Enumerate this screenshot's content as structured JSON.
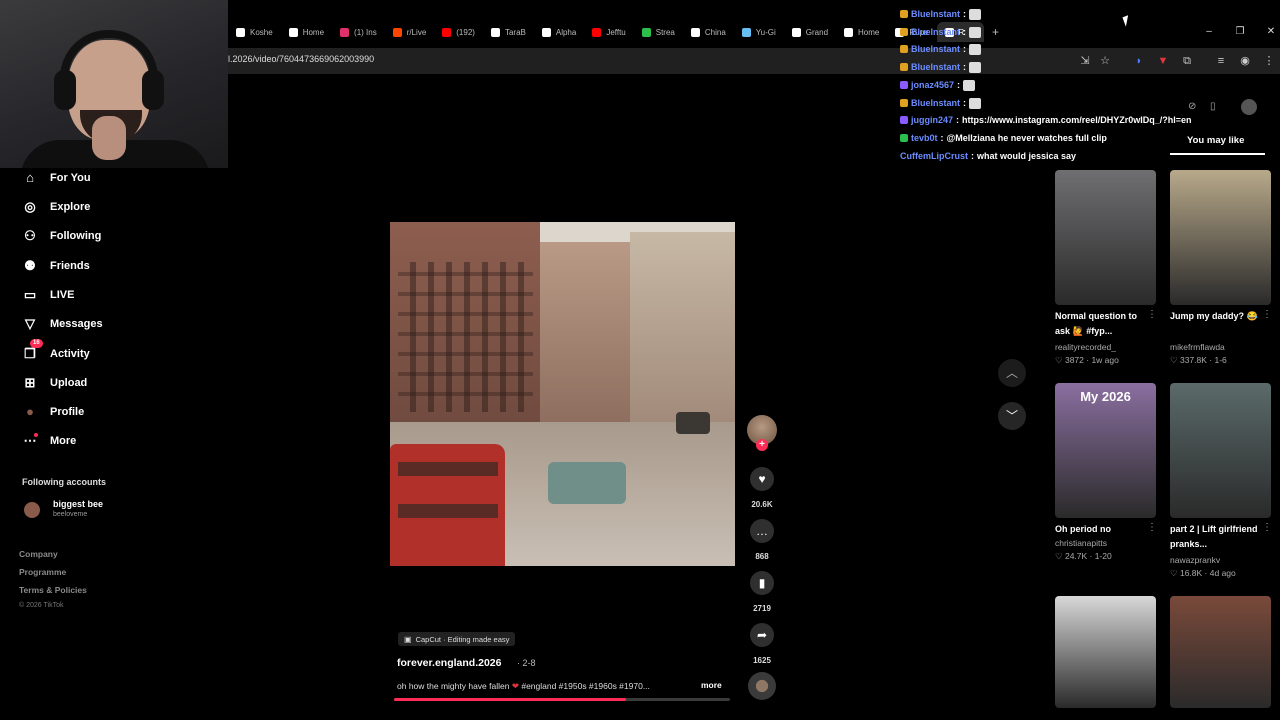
{
  "browser": {
    "tabs": [
      {
        "label": "Koshe",
        "icon": "x-logo-icon",
        "color": "#ffffff"
      },
      {
        "label": "Home",
        "icon": "x-logo-icon",
        "color": "#ffffff"
      },
      {
        "label": "(1) Ins",
        "icon": "instagram-icon",
        "color": "#e1306c"
      },
      {
        "label": "r/Live",
        "icon": "reddit-icon",
        "color": "#ff4500"
      },
      {
        "label": "(192)",
        "icon": "youtube-icon",
        "color": "#ff0000"
      },
      {
        "label": "TaraB",
        "icon": "x-logo-icon",
        "color": "#ffffff"
      },
      {
        "label": "Alpha",
        "icon": "x-logo-icon",
        "color": "#ffffff"
      },
      {
        "label": "Jefftu",
        "icon": "youtube-icon",
        "color": "#ff0000"
      },
      {
        "label": "Strea",
        "icon": "chart-icon",
        "color": "#2bbf4b"
      },
      {
        "label": "China",
        "icon": "x-logo-icon",
        "color": "#ffffff"
      },
      {
        "label": "Yu-Gi",
        "icon": "steam-icon",
        "color": "#66c0f4"
      },
      {
        "label": "Grand",
        "icon": "x-logo-icon",
        "color": "#ffffff"
      },
      {
        "label": "Home",
        "icon": "x-logo-icon",
        "color": "#ffffff"
      },
      {
        "label": "Rupe",
        "icon": "x-logo-icon",
        "color": "#ffffff"
      },
      {
        "label": "R",
        "icon": "tiktok-icon",
        "color": "#ffffff",
        "active": true
      }
    ],
    "new_tab": "+",
    "url": "l.2026/video/7604473669062003990",
    "window": {
      "minimize": "–",
      "restore": "❐",
      "close": "✕"
    }
  },
  "sidebar": {
    "items": [
      {
        "label": "For You",
        "icon": "home-icon",
        "glyph": "⌂"
      },
      {
        "label": "Explore",
        "icon": "compass-icon",
        "glyph": "◎"
      },
      {
        "label": "Following",
        "icon": "following-icon",
        "glyph": "⚇"
      },
      {
        "label": "Friends",
        "icon": "friends-icon",
        "glyph": "⚉"
      },
      {
        "label": "LIVE",
        "icon": "live-icon",
        "glyph": "▭"
      },
      {
        "label": "Messages",
        "icon": "messages-icon",
        "glyph": "▽"
      },
      {
        "label": "Activity",
        "icon": "activity-icon",
        "glyph": "❐",
        "badge": "16"
      },
      {
        "label": "Upload",
        "icon": "upload-icon",
        "glyph": "⊞"
      },
      {
        "label": "Profile",
        "icon": "profile-avatar-icon",
        "glyph": "●"
      },
      {
        "label": "More",
        "icon": "more-icon",
        "glyph": "⋯"
      }
    ],
    "following_title": "Following accounts",
    "following": [
      {
        "name": "biggest bee",
        "handle": "beeloveme"
      }
    ],
    "footer": [
      "Company",
      "Programme",
      "Terms & Policies"
    ],
    "copyright": "© 2026 TikTok"
  },
  "video": {
    "capcut": "CapCut · Editing made easy",
    "author": "forever.england.2026",
    "date": "· 2-8",
    "description": "oh how the mighty have fallen",
    "heart": "❤",
    "tags": "#england #1950s #1960s #1970...",
    "more": "more",
    "progress": 0.69
  },
  "actions": {
    "likes": "20.6K",
    "comments": "868",
    "saves": "2719",
    "shares": "1625"
  },
  "chat": [
    {
      "user": "BlueInstant",
      "text": "",
      "badge": "#e0a020",
      "emote": true
    },
    {
      "user": "BlueInstant",
      "text": "",
      "badge": "#e0a020",
      "emote": true
    },
    {
      "user": "BlueInstant",
      "text": "",
      "badge": "#e0a020",
      "emote": true
    },
    {
      "user": "BlueInstant",
      "text": "",
      "badge": "#e0a020",
      "emote": true
    },
    {
      "user": "jonaz4567",
      "text": "",
      "badge": "#8a5cff",
      "emote": true
    },
    {
      "user": "BlueInstant",
      "text": "",
      "badge": "#e0a020",
      "emote": true
    },
    {
      "user": "juggin247",
      "text": "https://www.instagram.com/reel/DHYZr0wIDq_/?hl=en",
      "badge": "#8a5cff",
      "emote": false
    },
    {
      "user": "tevb0t",
      "text": "@Mellziana he never watches full clip",
      "badge": "#2bbf4b",
      "emote": false
    },
    {
      "user": "CuffemLipCrust",
      "text": "what would jessica say",
      "badge": "",
      "emote": false
    }
  ],
  "recommendations": {
    "title": "You may like",
    "items": [
      {
        "title": "Normal question to ask 🙋 #fyp...",
        "author": "realityrecorded_",
        "stats": "♡ 3872 · 1w ago",
        "thumb": "#6f6f72"
      },
      {
        "title": "Jump my daddy? 😂",
        "author": "mikefrmflawda",
        "stats": "♡ 337.8K · 1-6",
        "thumb": "#b8a98a"
      },
      {
        "title": "Oh period no",
        "author": "christianapitts",
        "stats": "♡ 24.7K · 1-20",
        "thumb": "#8a6fa0",
        "overlay": "My 2026"
      },
      {
        "title": "part 2 | Lift girlfriend pranks...",
        "author": "nawazprankv",
        "stats": "♡ 16.8K · 4d ago",
        "thumb": "#5b6a6a"
      },
      {
        "title": "",
        "author": "",
        "stats": "",
        "thumb": "#d8d8d8"
      },
      {
        "title": "",
        "author": "",
        "stats": "",
        "thumb": "#7a4a3a"
      }
    ]
  },
  "colors": {
    "accent": "#fe2c55",
    "chat_user": "#6a8cff"
  }
}
